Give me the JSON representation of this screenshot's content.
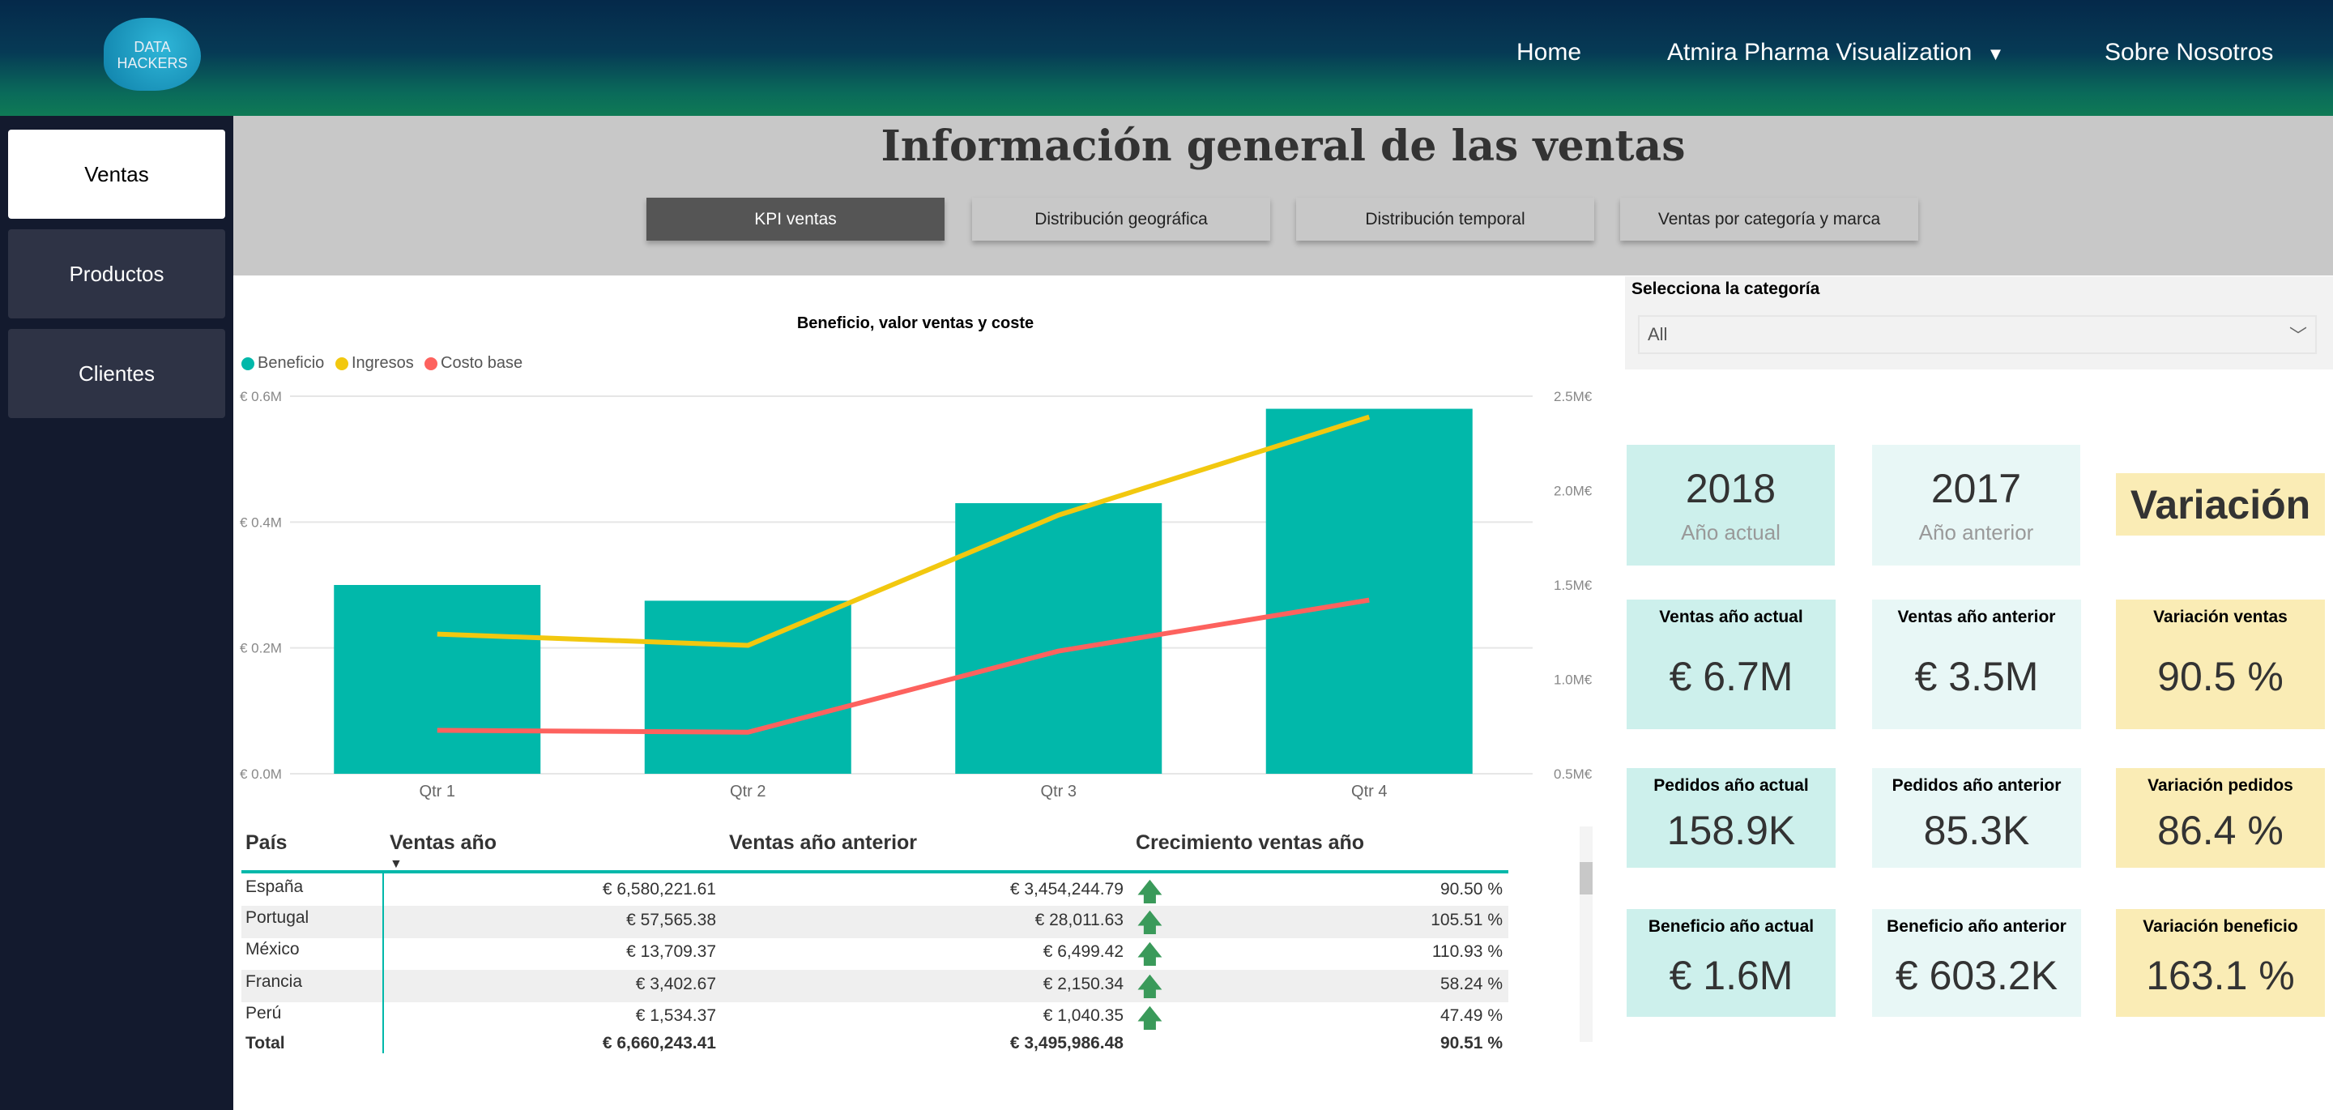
{
  "header": {
    "logo_text": "DATA HACKERS",
    "nav": [
      {
        "label": "Home"
      },
      {
        "label": "Atmira Pharma Visualization"
      },
      {
        "label": "Sobre Nosotros"
      }
    ]
  },
  "sidebar": {
    "items": [
      {
        "label": "Ventas"
      },
      {
        "label": "Productos"
      },
      {
        "label": "Clientes"
      }
    ]
  },
  "page_title": "Información general de las ventas",
  "tabs": [
    {
      "label": "KPI ventas"
    },
    {
      "label": "Distribución geográfica"
    },
    {
      "label": "Distribución temporal"
    },
    {
      "label": "Ventas por categoría y marca"
    }
  ],
  "chart_data": {
    "type": "bar+line",
    "title": "Beneficio, valor ventas y coste",
    "categories": [
      "Qtr 1",
      "Qtr 2",
      "Qtr 3",
      "Qtr 4"
    ],
    "series": [
      {
        "name": "Beneficio",
        "type": "bar",
        "axis": "left",
        "color": "#01b8aa",
        "values": [
          0.3,
          0.275,
          0.43,
          0.58
        ]
      },
      {
        "name": "Ingresos",
        "type": "line",
        "axis": "right",
        "color": "#f2c80f",
        "values": [
          1.24,
          1.18,
          1.87,
          2.39
        ]
      },
      {
        "name": "Costo base",
        "type": "line",
        "axis": "right",
        "color": "#fd625e",
        "values": [
          0.73,
          0.72,
          1.15,
          1.42
        ]
      }
    ],
    "left_axis": {
      "range": [
        0,
        0.6
      ],
      "ticks": [
        {
          "v": 0.6,
          "label": "€ 0.6M"
        },
        {
          "v": 0.4,
          "label": "€ 0.4M"
        },
        {
          "v": 0.2,
          "label": "€ 0.2M"
        },
        {
          "v": 0,
          "label": "€ 0.0M"
        }
      ]
    },
    "right_axis": {
      "range": [
        0.5,
        2.5
      ],
      "ticks": [
        {
          "v": 2.5,
          "label": "2.5M€"
        },
        {
          "v": 2.0,
          "label": "2.0M€"
        },
        {
          "v": 1.5,
          "label": "1.5M€"
        },
        {
          "v": 1.0,
          "label": "1.0M€"
        },
        {
          "v": 0.5,
          "label": "0.5M€"
        }
      ]
    },
    "legend": "top-left",
    "grid": true
  },
  "table": {
    "headers": [
      "País",
      "Ventas año",
      "Ventas año anterior",
      "Crecimiento ventas año"
    ],
    "rows": [
      {
        "pais": "España",
        "ventas": "€ 6,580,221.61",
        "anterior": "€ 3,454,244.79",
        "crec": "90.50 %"
      },
      {
        "pais": "Portugal",
        "ventas": "€ 57,565.38",
        "anterior": "€ 28,011.63",
        "crec": "105.51 %"
      },
      {
        "pais": "México",
        "ventas": "€ 13,709.37",
        "anterior": "€ 6,499.42",
        "crec": "110.93 %"
      },
      {
        "pais": "Francia",
        "ventas": "€ 3,402.67",
        "anterior": "€ 2,150.34",
        "crec": "58.24 %"
      },
      {
        "pais": "Perú",
        "ventas": "€ 1,534.37",
        "anterior": "€ 1,040.35",
        "crec": "47.49 %"
      }
    ],
    "total": {
      "pais": "Total",
      "ventas": "€ 6,660,243.41",
      "anterior": "€ 3,495,986.48",
      "crec": "90.51 %"
    }
  },
  "slicer": {
    "label": "Selecciona la categoría",
    "value": "All"
  },
  "kpis": {
    "year_current": "2018",
    "year_current_label": "Año actual",
    "year_previous": "2017",
    "year_previous_label": "Año anterior",
    "variation_title": "Variación",
    "cards": [
      {
        "label": "Ventas año actual",
        "value": "€ 6.7M"
      },
      {
        "label": "Ventas año anterior",
        "value": "€ 3.5M"
      },
      {
        "label": "Variación ventas",
        "value": "90.5 %"
      },
      {
        "label": "Pedidos año actual",
        "value": "158.9K"
      },
      {
        "label": "Pedidos año anterior",
        "value": "85.3K"
      },
      {
        "label": "Variación pedidos",
        "value": "86.4 %"
      },
      {
        "label": "Beneficio año actual",
        "value": "€ 1.6M"
      },
      {
        "label": "Beneficio año anterior",
        "value": "€ 603.2K"
      },
      {
        "label": "Variación beneficio",
        "value": "163.1 %"
      }
    ]
  }
}
